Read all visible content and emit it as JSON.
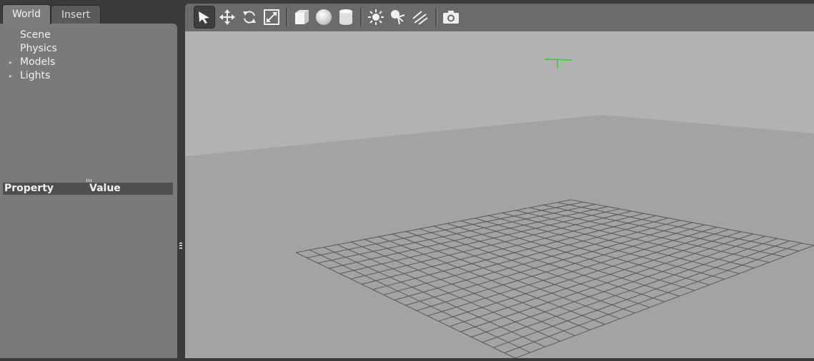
{
  "tabs": {
    "world": "World",
    "insert": "Insert"
  },
  "tree": {
    "items": [
      {
        "label": "Scene",
        "expandable": false
      },
      {
        "label": "Physics",
        "expandable": false
      },
      {
        "label": "Models",
        "expandable": true
      },
      {
        "label": "Lights",
        "expandable": true
      }
    ]
  },
  "properties": {
    "col_property": "Property",
    "col_value": "Value"
  },
  "toolbar": {
    "tools": [
      "select-arrow",
      "translate-mode",
      "rotate-mode",
      "scale-mode",
      "box-shape",
      "sphere-shape",
      "cylinder-shape",
      "point-light",
      "spot-light",
      "directional-light",
      "screenshot"
    ],
    "active": "select-arrow"
  },
  "viewport": {
    "wall_color": "#b2b2b2",
    "floor_color": "#a3a3a3",
    "grid_color": "#595959",
    "origin_marker_color": "#19e019"
  }
}
